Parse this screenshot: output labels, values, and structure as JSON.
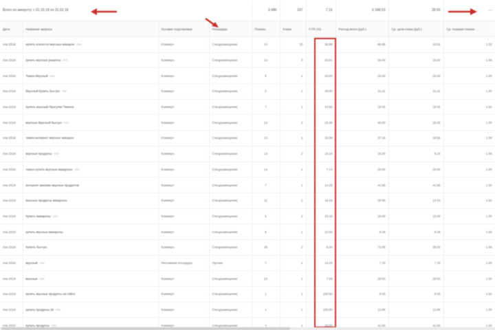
{
  "totals": {
    "label": "Всего по аккаунту: c 01.03.18 по 31.03.18",
    "impressions": "3 486",
    "clicks": "337",
    "ctr": "7.16",
    "cost": "5 348.53",
    "avg_cpc": "28.93",
    "last": "—"
  },
  "headers": [
    "Дата",
    "Название запроса",
    "Условие подстановки",
    "Площадка",
    "Показы",
    "Клики",
    "CTR (%)",
    "Расход всего (руб.)",
    "Ср. цена клика (руб.)",
    "Ср. позиция показа"
  ],
  "rows": [
    {
      "date": "mar.2018",
      "keyword": "купить ксилитол вкусных макарон",
      "tag": "mix",
      "cond": "Коммерч.",
      "place": "Спецразмещение",
      "shows": "14",
      "clicks": "10",
      "ctr": "28.99",
      "cost": "80.88",
      "cpc": "10.02",
      "pos": "1.02"
    },
    {
      "date": "mar.2018",
      "keyword": "купить вкусные рецепты",
      "tag": "mix",
      "cond": "Коммерч.",
      "place": "Спецразмещение",
      "shows": "12",
      "clicks": "3",
      "ctr": "24.91",
      "cost": "59.06",
      "cpc": "19.60",
      "pos": "1.00"
    },
    {
      "date": "mar.2018",
      "keyword": "Тимон Вкусный",
      "tag": "mix",
      "cond": "Коммерч.",
      "place": "Спецразмещение",
      "shows": "5",
      "clicks": "1",
      "ctr": "20.00",
      "cost": "15.60",
      "cpc": "15.60",
      "pos": "1.00"
    },
    {
      "date": "mar.2018",
      "keyword": "Вкусный Купить быстро",
      "tag": "mix",
      "cond": "Коммерч.",
      "place": "Спецразмещение",
      "shows": "5",
      "clicks": "1",
      "ctr": "20.00",
      "cost": "12.31",
      "cpc": "12.31",
      "pos": "1.00"
    },
    {
      "date": "mar.2018",
      "keyword": "Купить вкусный Прогулки Тимона",
      "tag": "",
      "cond": "Коммерч.",
      "place": "Спецразмещение",
      "shows": "7",
      "clicks": "1",
      "ctr": "14.50",
      "cost": "15.02",
      "cpc": "15.02",
      "pos": "1.00"
    },
    {
      "date": "mar.2018",
      "keyword": "вкусные Вкусный быстро",
      "tag": "mix",
      "cond": "Коммерч.",
      "place": "Спецразмещение",
      "shows": "13",
      "clicks": "2",
      "ctr": "15.38",
      "cost": "40.50",
      "cpc": "20.25",
      "pos": "1.00"
    },
    {
      "date": "mar.2018",
      "keyword": "тимон интернет вкусных макарон",
      "tag": "",
      "cond": "Коммерч.",
      "place": "Спецразмещение",
      "shows": "13",
      "clicks": "2",
      "ctr": "15.38",
      "cost": "37.18",
      "cpc": "18.59",
      "pos": "1.00"
    },
    {
      "date": "mar.2018",
      "keyword": "вкусные продукты",
      "tag": "mix",
      "cond": "Коммерч.",
      "place": "Спецразмещение",
      "shows": "14",
      "clicks": "2",
      "ctr": "14.29",
      "cost": "16.30",
      "cpc": "8.15",
      "pos": "1.00"
    },
    {
      "date": "mar.2018",
      "keyword": "тимон купить вкусные макароны",
      "tag": "mix",
      "cond": "Коммерч.",
      "place": "Спецразмещение",
      "shows": "14",
      "clicks": "1",
      "ctr": "7.14",
      "cost": "24.06",
      "cpc": "24.06",
      "pos": "1.00"
    },
    {
      "date": "mar.2018",
      "keyword": "интернет магазин вкусных продуктов",
      "tag": "",
      "cond": "Коммерч.",
      "place": "Спецразмещение",
      "shows": "7",
      "clicks": "1",
      "ctr": "14.29",
      "cost": "41.60",
      "cpc": "41.60",
      "pos": "1.00"
    },
    {
      "date": "mar.2018",
      "keyword": "вкусные продукты макароны",
      "tag": "",
      "cond": "Коммерч.",
      "place": "Спецразмещение",
      "shows": "11",
      "clicks": "2",
      "ctr": "18.18",
      "cost": "29.08",
      "cpc": "14.54",
      "pos": "1.00"
    },
    {
      "date": "mar.2018",
      "keyword": "Купить макароны",
      "tag": "mix",
      "cond": "Коммерч.",
      "place": "Спецразмещение",
      "shows": "6",
      "clicks": "2",
      "ctr": "33.33",
      "cost": "26.00",
      "cpc": "13.00",
      "pos": "1.00"
    },
    {
      "date": "mar.2018",
      "keyword": "купить вкусные макароны",
      "tag": "",
      "cond": "Коммерч.",
      "place": "Спецразмещение",
      "shows": "8",
      "clicks": "1",
      "ctr": "12.50",
      "cost": "9.36",
      "cpc": "9.36",
      "pos": "1.00"
    },
    {
      "date": "mar.2018",
      "keyword": "Купить быстро",
      "tag": "",
      "cond": "Коммерч.",
      "place": "Спецразмещение",
      "shows": "25",
      "clicks": "2",
      "ctr": "8.00",
      "cost": "72.06",
      "cpc": "36.03",
      "pos": "1.00"
    },
    {
      "date": "mar.2018",
      "keyword": "вкусный",
      "tag": "mix",
      "cond": "Рекламная площадка",
      "place": "Прочие",
      "shows": "7",
      "clicks": "1",
      "ctr": "14.29",
      "cost": "7.78",
      "cpc": "7.78",
      "pos": "1.00"
    },
    {
      "date": "mar.2018",
      "keyword": "вкусные",
      "tag": "mix",
      "cond": "Коммерч.",
      "place": "Спецразмещение",
      "shows": "13",
      "clicks": "1",
      "ctr": "7.69",
      "cost": "28.53",
      "cpc": "28.53",
      "pos": "1.00"
    },
    {
      "date": "mar.2018",
      "keyword": "купить вкусные продукты на сайте",
      "tag": "",
      "cond": "Коммерч.",
      "place": "Спецразмещение",
      "shows": "1",
      "clicks": "1",
      "ctr": "100.00",
      "cost": "9.40",
      "cpc": "9.40",
      "pos": "1.00"
    },
    {
      "date": "mar.2018",
      "keyword": "купить продукты 30",
      "tag": "mix",
      "cond": "Коммерч.",
      "place": "Спецразмещение",
      "shows": "1",
      "clicks": "1",
      "ctr": "100.00",
      "cost": "12.96",
      "cpc": "12.96",
      "pos": "1.00"
    },
    {
      "date": "mar.2018",
      "keyword": "купить продукты",
      "tag": "mix",
      "cond": "Коммерч.",
      "place": "Спецразмещение",
      "shows": "4",
      "clicks": "1",
      "ctr": "25.00",
      "cost": "41.60",
      "cpc": "41.60",
      "pos": "1.00"
    }
  ],
  "colors": {
    "highlight": "#c9302c",
    "arrow": "#c9302c"
  }
}
